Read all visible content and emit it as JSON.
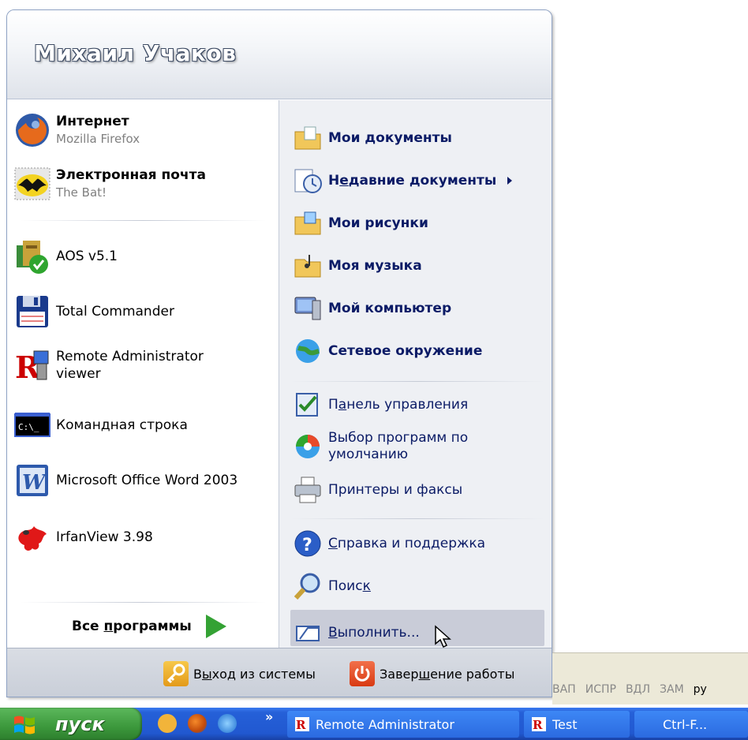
{
  "user": {
    "name": "Михаил Учаков"
  },
  "pinned": [
    {
      "title": "Интернет",
      "subtitle": "Mozilla Firefox",
      "icon": "firefox-icon"
    },
    {
      "title": "Электронная почта",
      "subtitle": "The Bat!",
      "icon": "the-bat-icon"
    }
  ],
  "recent": [
    {
      "label": "AOS v5.1",
      "icon": "aos-icon"
    },
    {
      "label": "Total Commander",
      "icon": "floppy-disk-icon"
    },
    {
      "label": "Remote Administrator",
      "label2": "viewer",
      "icon": "radmin-icon"
    },
    {
      "label": "Командная строка",
      "icon": "command-prompt-icon"
    },
    {
      "label": "Microsoft Office Word 2003",
      "icon": "word-icon"
    },
    {
      "label": "IrfanView 3.98",
      "icon": "irfanview-icon"
    }
  ],
  "all_programs": {
    "before": "Все ",
    "underlined": "п",
    "after": "рограммы"
  },
  "right": {
    "my_documents": "Мои документы",
    "recent_docs": {
      "before": "Н",
      "underlined": "е",
      "after": "давние документы"
    },
    "my_pictures": "Мои рисунки",
    "my_music": "Моя музыка",
    "my_computer": "Мой компьютер",
    "network": "Сетевое окружение",
    "control_panel": {
      "before": "П",
      "underlined": "а",
      "after": "нель управления"
    },
    "default_programs": {
      "line1": "Выбор программ по",
      "line2": "умолчанию"
    },
    "printers": "Принтеры и факсы",
    "help": {
      "underlined": "С",
      "after": "правка и поддержка"
    },
    "search": {
      "before": "Поис",
      "underlined": "к",
      "after": ""
    },
    "run": {
      "underlined": "В",
      "after": "ыполнить..."
    }
  },
  "footer": {
    "logoff": {
      "before": "В",
      "underlined": "ы",
      "after": "ход из системы"
    },
    "shutdown": {
      "before": "Завер",
      "underlined": "ш",
      "after": "ение работы"
    }
  },
  "statusbar": {
    "items": [
      "ВАП",
      "ИСПР",
      "ВДЛ",
      "ЗАМ",
      "ру"
    ]
  },
  "taskbar": {
    "start": "пуск",
    "more": "»",
    "tasks": [
      {
        "label": "Remote Administrator"
      },
      {
        "label": "Test"
      },
      {
        "label": "Ctrl-F..."
      }
    ]
  },
  "colors": {
    "accent_blue": "#2158d0",
    "start_green": "#3c983c",
    "link_text": "#0b1b66"
  }
}
